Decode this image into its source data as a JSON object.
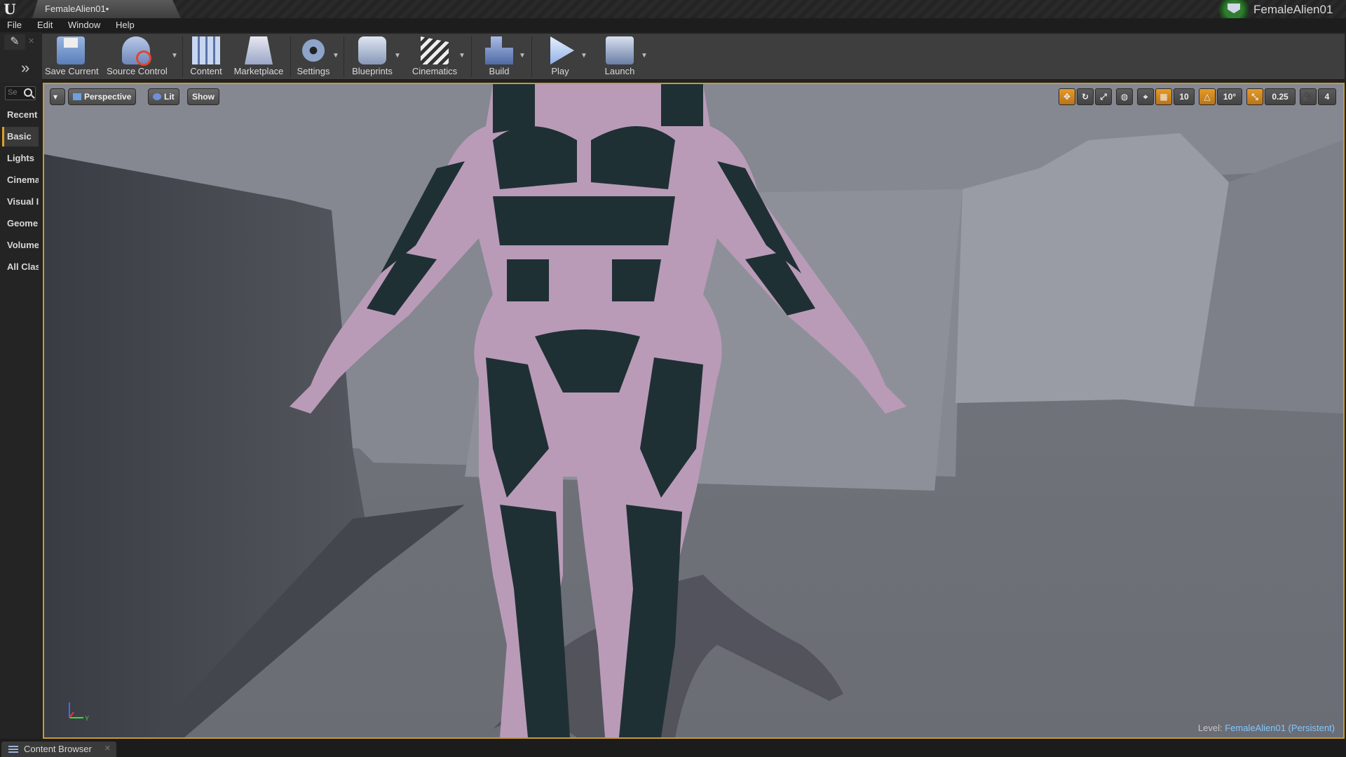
{
  "window": {
    "tab_title": "FemaleAlien01•",
    "project_name": "FemaleAlien01"
  },
  "menu": [
    "File",
    "Edit",
    "Window",
    "Help"
  ],
  "toolbar": [
    {
      "label": "Save Current",
      "icon": "save-icon",
      "dropdown": false
    },
    {
      "label": "Source Control",
      "icon": "source-control-icon",
      "dropdown": true
    },
    {
      "label": "Content",
      "icon": "content-icon",
      "dropdown": false
    },
    {
      "label": "Marketplace",
      "icon": "marketplace-icon",
      "dropdown": false
    },
    {
      "label": "Settings",
      "icon": "settings-icon",
      "dropdown": true
    },
    {
      "label": "Blueprints",
      "icon": "blueprints-icon",
      "dropdown": true
    },
    {
      "label": "Cinematics",
      "icon": "cinematics-icon",
      "dropdown": true
    },
    {
      "label": "Build",
      "icon": "build-icon",
      "dropdown": true
    },
    {
      "label": "Play",
      "icon": "play-icon",
      "dropdown": true
    },
    {
      "label": "Launch",
      "icon": "launch-icon",
      "dropdown": true
    }
  ],
  "place_panel": {
    "search_placeholder": "Se",
    "items": [
      "Recent",
      "Basic",
      "Lights",
      "Cinema",
      "Visual I",
      "Geome",
      "Volume",
      "All Clas"
    ],
    "active": "Basic"
  },
  "viewport": {
    "view_mode": "Perspective",
    "lighting": "Lit",
    "show": "Show",
    "grid_snap": "10",
    "rotation_snap": "10°",
    "scale_snap": "0.25",
    "camera_speed": "4",
    "level_label": "Level:",
    "level_name": "FemaleAlien01 (Persistent)",
    "axis_y": "Y"
  },
  "bottom": {
    "content_browser": "Content Browser"
  },
  "colors": {
    "accent_orange": "#e69a28",
    "viewport_border": "#c89a30",
    "level_name": "#80c8ff"
  }
}
